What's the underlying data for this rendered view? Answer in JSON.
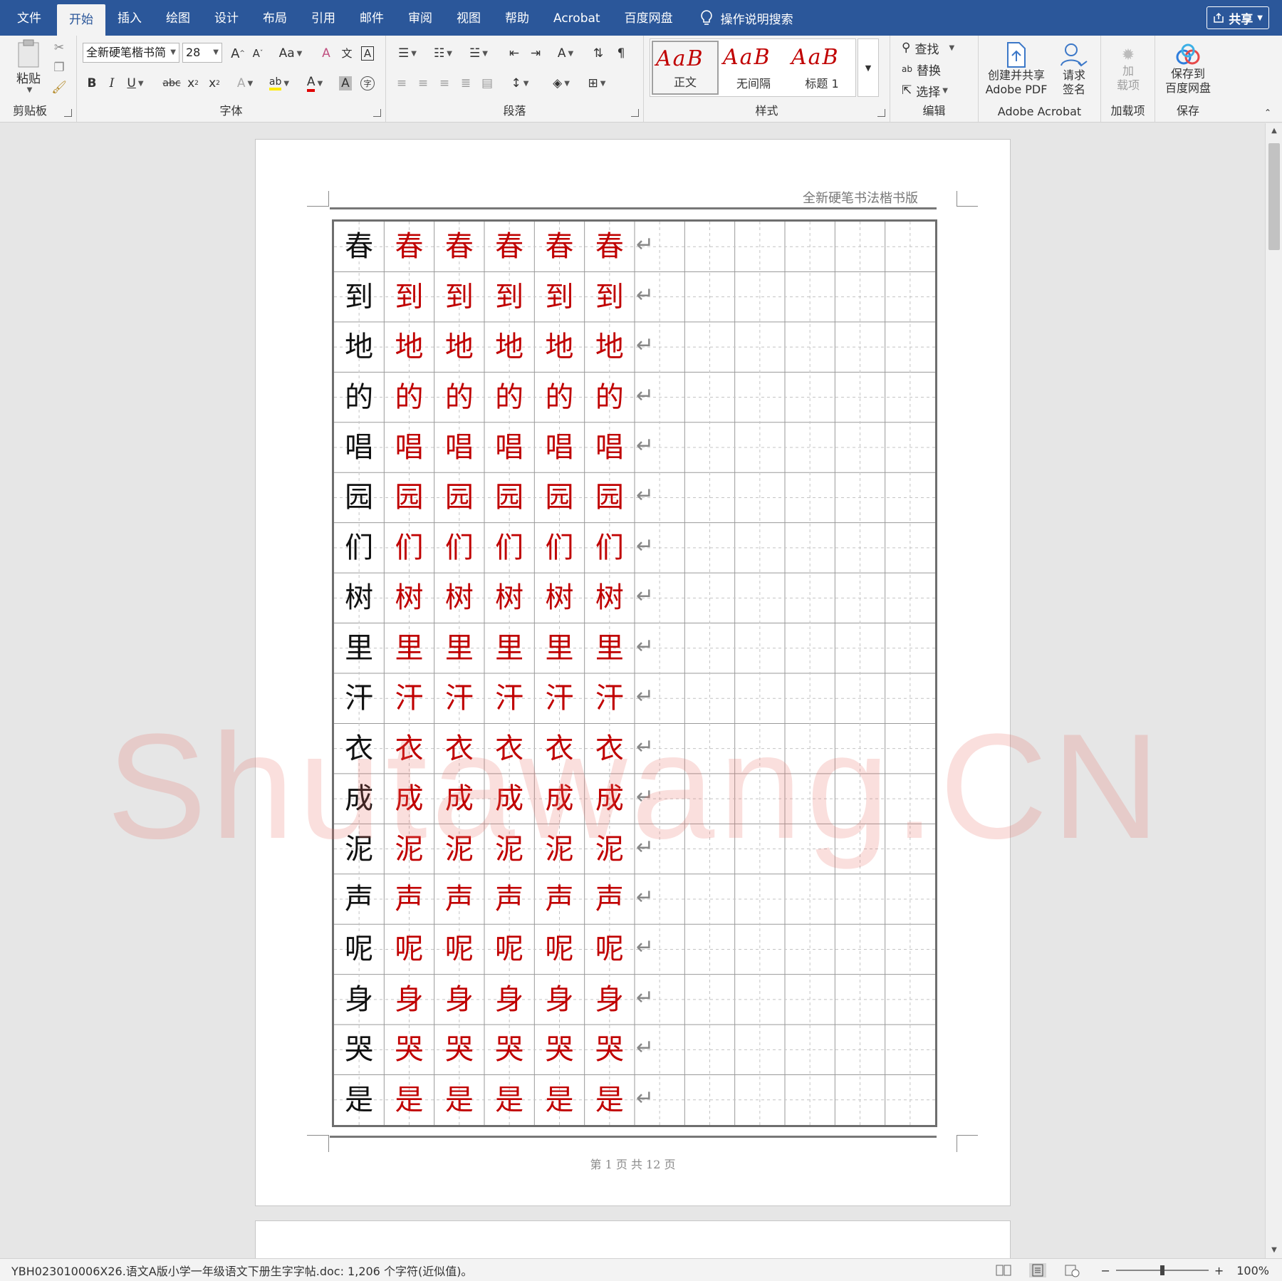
{
  "tabs": [
    "文件",
    "开始",
    "插入",
    "绘图",
    "设计",
    "布局",
    "引用",
    "邮件",
    "审阅",
    "视图",
    "帮助",
    "Acrobat",
    "百度网盘"
  ],
  "active_tab_index": 1,
  "search": {
    "label": "操作说明搜索"
  },
  "share": {
    "label": "共享"
  },
  "ribbon": {
    "clipboard": {
      "paste": "粘贴",
      "group_label": "剪贴板"
    },
    "font": {
      "font_name": "全新硬笔楷书简",
      "font_size": "28",
      "change_case": "Aa",
      "group_label": "字体"
    },
    "paragraph": {
      "group_label": "段落"
    },
    "styles": {
      "items": [
        {
          "sample": "AaB",
          "name": "正文"
        },
        {
          "sample": "AaB",
          "name": "无间隔"
        },
        {
          "sample": "AaB",
          "name": "标题 1"
        }
      ],
      "group_label": "样式"
    },
    "editing": {
      "find": "查找",
      "replace": "替换",
      "select": "选择",
      "group_label": "编辑"
    },
    "acrobat": {
      "create_line1": "创建并共享",
      "create_line2": "Adobe PDF",
      "sign_line1": "请求",
      "sign_line2": "签名",
      "group_label": "Adobe Acrobat"
    },
    "addins": {
      "line1": "加",
      "line2": "载项",
      "group_label": "加载项"
    },
    "save": {
      "line1": "保存到",
      "line2": "百度网盘",
      "group_label": "保存"
    }
  },
  "document": {
    "header": "全新硬笔书法楷书版",
    "footer": "第 1 页 共 12 页",
    "grid_columns": 12,
    "trace_copies": 5,
    "characters": [
      "春",
      "到",
      "地",
      "的",
      "唱",
      "园",
      "们",
      "树",
      "里",
      "汗",
      "衣",
      "成",
      "泥",
      "声",
      "呢",
      "身",
      "哭",
      "是"
    ]
  },
  "colors": {
    "tab_bar": "#2b579a",
    "trace_red": "#c00000",
    "model_black": "#111111"
  },
  "watermark": "Shutawang.CN",
  "status_bar": {
    "text": "YBH023010006X26.语文A版小学一年级语文下册生字字帖.doc: 1,206 个字符(近似值)。",
    "zoom": "100%"
  }
}
